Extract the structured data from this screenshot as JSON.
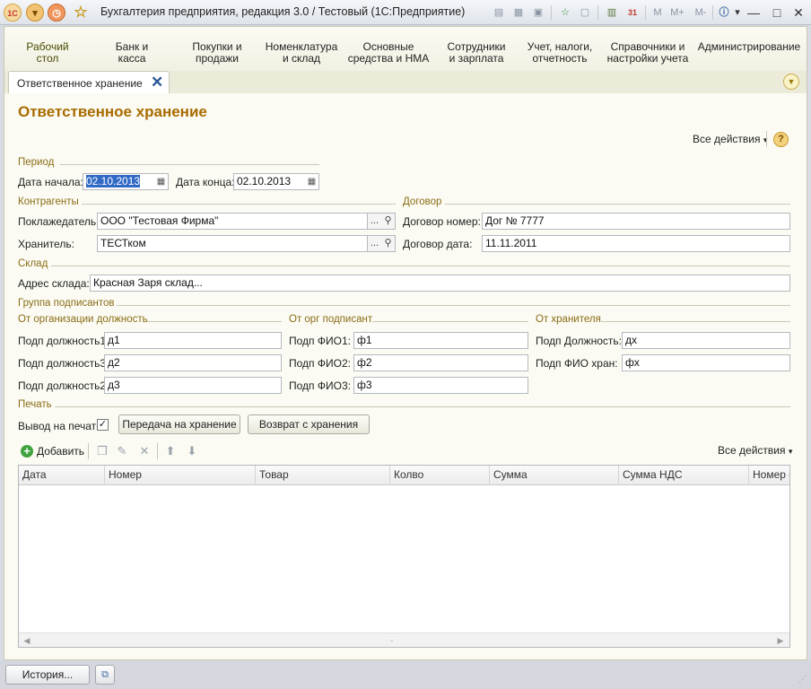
{
  "titlebar": {
    "logo_text": "1С",
    "title": "Бухгалтерия предприятия, редакция 3.0 / Тестовый  (1С:Предприятие)",
    "memory_buttons": [
      "M",
      "M+",
      "M-"
    ],
    "calendar_day": "31"
  },
  "sections": [
    {
      "label": "Рабочий\nстол"
    },
    {
      "label": "Банк и\nкасса"
    },
    {
      "label": "Покупки и\nпродажи"
    },
    {
      "label": "Номенклатура\nи склад"
    },
    {
      "label": "Основные\nсредства и НМА"
    },
    {
      "label": "Сотрудники\nи зарплата"
    },
    {
      "label": "Учет, налоги,\nотчетность"
    },
    {
      "label": "Справочники и\nнастройки учета"
    },
    {
      "label": "Администрирование"
    }
  ],
  "tab": {
    "label": "Ответственное хранение",
    "close": "✕"
  },
  "form": {
    "title": "Ответственное хранение",
    "all_actions": "Все действия",
    "help": "?",
    "period": {
      "group_title": "Период",
      "start_label": "Дата начала:",
      "start_value": "02.10.2013",
      "end_label": "Дата конца:",
      "end_value": "02.10.2013"
    },
    "counterparties": {
      "group_title": "Контрагенты",
      "depositor_label": "Поклажедатель:",
      "depositor_value": "ООО \"Тестовая Фирма\"",
      "keeper_label": "Хранитель:",
      "keeper_value": "ТЕСТком",
      "select_button": "..."
    },
    "contract": {
      "group_title": "Договор",
      "number_label": "Договор номер:",
      "number_value": "Дог № 7777",
      "date_label": "Договор дата:",
      "date_value": "11.11.2011"
    },
    "warehouse": {
      "group_title": "Склад",
      "address_label": "Адрес склада:",
      "address_value": "Красная Заря склад..."
    },
    "signers": {
      "group_title": "Группа подписантов",
      "org_positions": {
        "group_title": "От организации должность",
        "rows": [
          {
            "label": "Подп должность1:",
            "value": "д1"
          },
          {
            "label": "Подп должность3:",
            "value": "д2"
          },
          {
            "label": "Подп должность2:",
            "value": "д3"
          }
        ]
      },
      "org_signers": {
        "group_title": "От орг подписант",
        "rows": [
          {
            "label": "Подп ФИО1:",
            "value": "ф1"
          },
          {
            "label": "Подп ФИО2:",
            "value": "ф2"
          },
          {
            "label": "Подп ФИО3:",
            "value": "ф3"
          }
        ]
      },
      "keeper_signer": {
        "group_title": "От хранителя",
        "rows": [
          {
            "label": "Подп Должность:",
            "value": "дх"
          },
          {
            "label": "Подп ФИО хран:",
            "value": "фх"
          }
        ]
      }
    },
    "print": {
      "group_title": "Печать",
      "output_label": "Вывод на печать:",
      "output_checked": "✓",
      "transfer_button": "Передача на хранение",
      "return_button": "Возврат с хранения"
    },
    "table_toolbar": {
      "add_label": "Добавить",
      "all_actions": "Все действия"
    },
    "table": {
      "columns": [
        "Дата",
        "Номер",
        "Товар",
        "Колво",
        "Сумма",
        "Сумма НДС",
        "Номер с"
      ],
      "rows": []
    }
  },
  "statusbar": {
    "history_button": "История..."
  }
}
